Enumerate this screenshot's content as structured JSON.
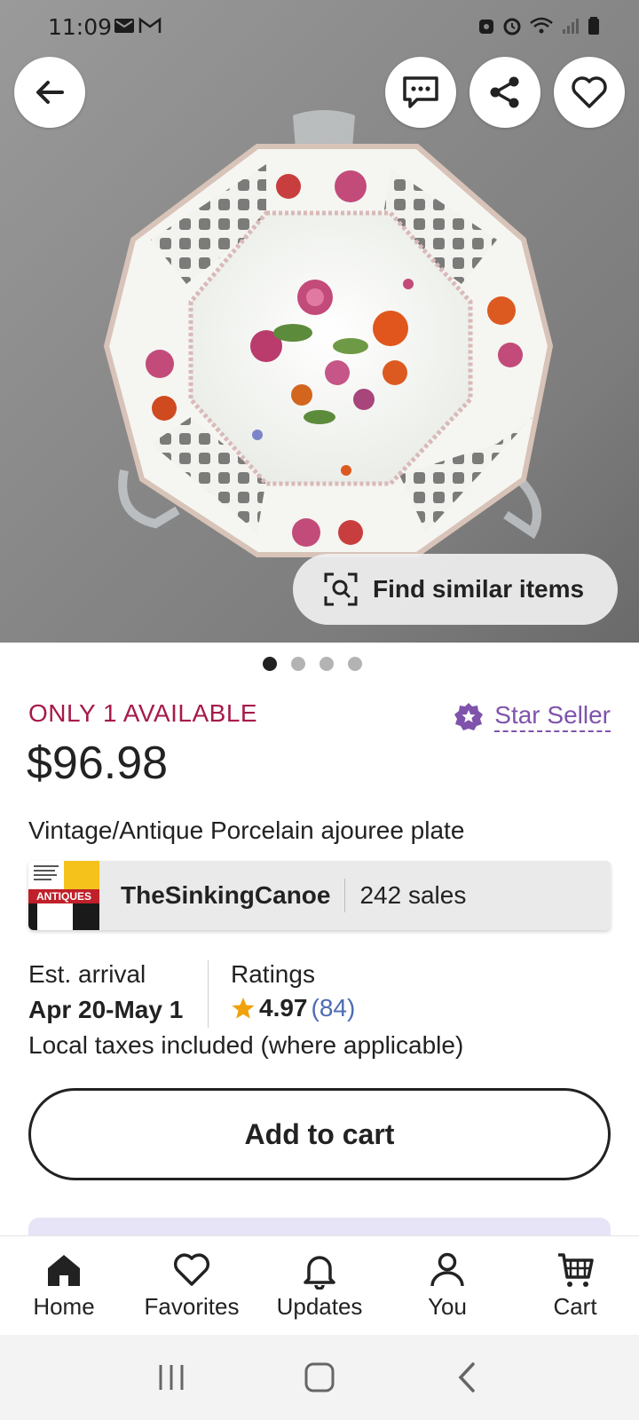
{
  "status_bar": {
    "time": "11:09",
    "left_icons": [
      "mail-icon",
      "gmail-icon"
    ],
    "right_icons": [
      "vpn-icon",
      "alarm-icon",
      "wifi-icon",
      "signal-icon",
      "battery-icon"
    ]
  },
  "hero": {
    "find_similar_label": "Find similar items",
    "image_count": 4,
    "active_image_index": 0
  },
  "listing": {
    "availability": "ONLY 1 AVAILABLE",
    "star_seller_label": "Star Seller",
    "price": "$96.98",
    "title": "Vintage/Antique Porcelain ajouree plate"
  },
  "shop": {
    "name": "TheSinkingCanoe",
    "sales": "242 sales",
    "logo_text": "ANTIQUES"
  },
  "delivery": {
    "arrival_label": "Est. arrival",
    "arrival_value": "Apr 20-May 1",
    "ratings_label": "Ratings",
    "rating_score": "4.97",
    "rating_count": "(84)",
    "taxes_note": "Local taxes included (where applicable)"
  },
  "actions": {
    "add_to_cart": "Add to cart"
  },
  "bottom_nav": {
    "items": [
      {
        "label": "Home",
        "icon": "home-icon"
      },
      {
        "label": "Favorites",
        "icon": "heart-icon"
      },
      {
        "label": "Updates",
        "icon": "bell-icon"
      },
      {
        "label": "You",
        "icon": "person-icon"
      },
      {
        "label": "Cart",
        "icon": "cart-icon"
      }
    ]
  },
  "colors": {
    "availability": "#a61a4b",
    "star_seller": "#7f53ac",
    "rating_count": "#4d6bb3",
    "star": "#f1a10a"
  }
}
